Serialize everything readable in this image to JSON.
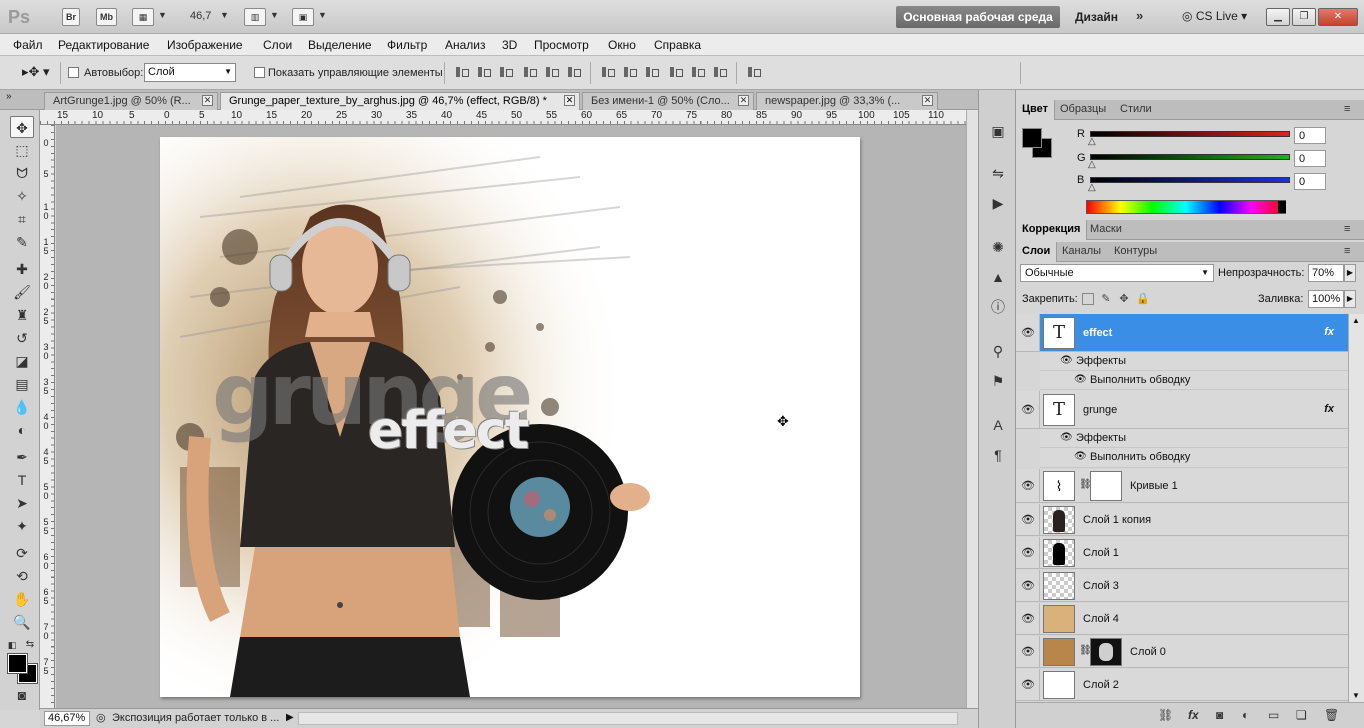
{
  "appbar": {
    "logo": "Ps",
    "br": "Br",
    "mb": "Mb",
    "zoom": "46,7",
    "workspace": "Основная рабочая среда",
    "design": "Дизайн",
    "cs_live": "CS Live"
  },
  "menu": [
    "Файл",
    "Редактирование",
    "Изображение",
    "Слои",
    "Выделение",
    "Фильтр",
    "Анализ",
    "3D",
    "Просмотр",
    "Окно",
    "Справка"
  ],
  "options": {
    "autoselect_label": "Автовыбор:",
    "autoselect_value": "Слой",
    "show_controls_label": "Показать управляющие элементы"
  },
  "tabs": [
    {
      "label": "ArtGrunge1.jpg @ 50% (R..."
    },
    {
      "label": "Grunge_paper_texture_by_arghus.jpg @ 46,7% (effect, RGB/8) *"
    },
    {
      "label": "Без имени-1 @ 50% (Сло..."
    },
    {
      "label": "newspaper.jpg @ 33,3% (..."
    }
  ],
  "ruler_top": [
    "15",
    "10",
    "5",
    "0",
    "5",
    "10",
    "15",
    "20",
    "25",
    "30",
    "35",
    "40",
    "45",
    "50",
    "55",
    "60",
    "65",
    "70",
    "75",
    "80",
    "85",
    "90",
    "95",
    "100",
    "105",
    "110"
  ],
  "ruler_left": [
    "0",
    "5",
    "1 0",
    "1 5",
    "2 0",
    "2 5",
    "3 0",
    "3 5",
    "4 0",
    "4 5",
    "5 0",
    "5 5",
    "6 0",
    "6 5",
    "7 0",
    "7 5"
  ],
  "artwork": {
    "word1": "grunge",
    "word2": "effect"
  },
  "status": {
    "zoom": "46,67%",
    "message": "Экспозиция работает только в ..."
  },
  "color_panel": {
    "tabs": [
      "Цвет",
      "Образцы",
      "Стили"
    ],
    "channels": [
      {
        "name": "R",
        "value": "0",
        "color": "#e02020"
      },
      {
        "name": "G",
        "value": "0",
        "color": "#20b020"
      },
      {
        "name": "B",
        "value": "0",
        "color": "#2030e0"
      }
    ],
    "foreground": "#000000",
    "background": "#000000"
  },
  "adjust_panel": {
    "tabs": [
      "Коррекция",
      "Маски"
    ]
  },
  "layers_panel": {
    "tabs": [
      "Слои",
      "Каналы",
      "Контуры"
    ],
    "blend_mode": "Обычные",
    "opacity_label": "Непрозрачность:",
    "opacity": "70%",
    "lock_label": "Закрепить:",
    "fill_label": "Заливка:",
    "fill": "100%",
    "layers": [
      {
        "name": "effect",
        "kind": "text",
        "fx": "fx",
        "effects_label": "Эффекты",
        "effect": "Выполнить обводку",
        "selected": true
      },
      {
        "name": "grunge",
        "kind": "text",
        "fx": "fx",
        "effects_label": "Эффекты",
        "effect": "Выполнить обводку",
        "selected": false
      },
      {
        "name": "Кривые 1",
        "kind": "adjustment"
      },
      {
        "name": "Слой 1 копия",
        "kind": "image"
      },
      {
        "name": "Слой 1",
        "kind": "image"
      },
      {
        "name": "Слой 3",
        "kind": "transparent"
      },
      {
        "name": "Слой 4",
        "kind": "texture"
      },
      {
        "name": "Слой 0",
        "kind": "masked"
      },
      {
        "name": "Слой 2",
        "kind": "white"
      }
    ]
  }
}
